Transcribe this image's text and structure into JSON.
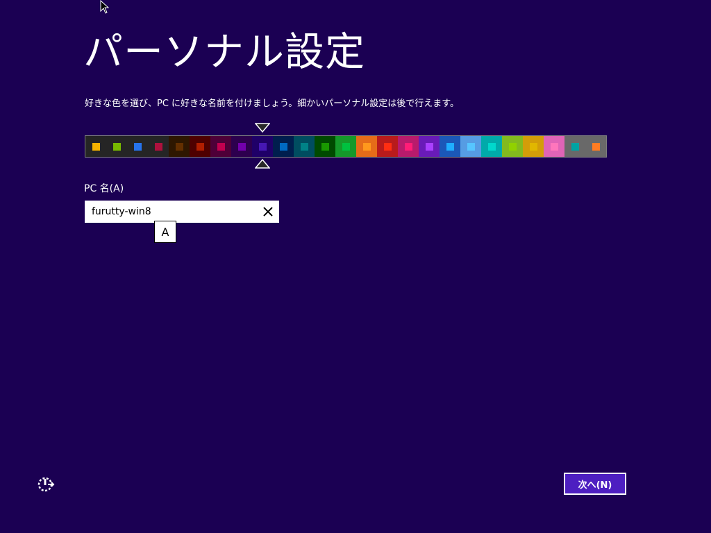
{
  "title": "パーソナル設定",
  "instructions": "好きな色を選び、PC に好きな名前を付けましょう。細かいパーソナル設定は後で行えます。",
  "palette": {
    "selected_index": 8,
    "swatches": [
      {
        "bg": "#252525",
        "chip": "#f4b300"
      },
      {
        "bg": "#252525",
        "chip": "#78ba00"
      },
      {
        "bg": "#252525",
        "chip": "#2673ec"
      },
      {
        "bg": "#252525",
        "chip": "#ae113d"
      },
      {
        "bg": "#2e1700",
        "chip": "#632f00"
      },
      {
        "bg": "#4e0000",
        "chip": "#b01e00"
      },
      {
        "bg": "#4e0038",
        "chip": "#c1004f"
      },
      {
        "bg": "#2d004e",
        "chip": "#7200ac"
      },
      {
        "bg": "#1f0068",
        "chip": "#4617b4"
      },
      {
        "bg": "#001e4e",
        "chip": "#006ac1"
      },
      {
        "bg": "#004d60",
        "chip": "#008287"
      },
      {
        "bg": "#004a00",
        "chip": "#199900"
      },
      {
        "bg": "#15992a",
        "chip": "#00c13f"
      },
      {
        "bg": "#e56c19",
        "chip": "#ff981d"
      },
      {
        "bg": "#b81b1b",
        "chip": "#ff2e12"
      },
      {
        "bg": "#b81b6c",
        "chip": "#ff1d77"
      },
      {
        "bg": "#691bb8",
        "chip": "#aa40ff"
      },
      {
        "bg": "#1b58b8",
        "chip": "#1faeff"
      },
      {
        "bg": "#569ce3",
        "chip": "#56c5ff"
      },
      {
        "bg": "#00aaaa",
        "chip": "#00d8cc"
      },
      {
        "bg": "#83ba1f",
        "chip": "#91d100"
      },
      {
        "bg": "#d39d09",
        "chip": "#e1b700"
      },
      {
        "bg": "#e064b7",
        "chip": "#ff76bc"
      },
      {
        "bg": "#696969",
        "chip": "#00a3a3"
      },
      {
        "bg": "#696969",
        "chip": "#fe7c22"
      }
    ]
  },
  "pc_name": {
    "label": "PC 名(A)",
    "value": "furutty-win8",
    "clear_icon": "close-icon"
  },
  "ime_mode": "A",
  "ease_of_access_icon": "ease-of-access-icon",
  "next_button": "次へ(N)",
  "colors": {
    "background": "#1b0053",
    "accent": "#4d1fc1"
  }
}
